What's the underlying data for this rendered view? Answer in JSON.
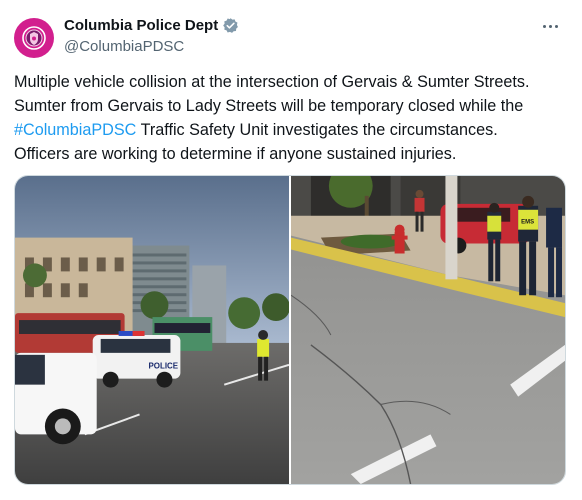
{
  "account": {
    "display_name": "Columbia Police Dept",
    "handle": "@ColumbiaPDSC",
    "verified": true,
    "avatar_color": "#d21f8e"
  },
  "tweet": {
    "line1": "Multiple vehicle collision at the intersection of Gervais & Sumter Streets.",
    "line2": "Sumter from Gervais to Lady Streets will be temporary closed while the",
    "line3_hashtag": "#ColumbiaPDSC",
    "line3_rest": " Traffic Safety Unit investigates the circumstances.",
    "line4": "Officers are working to determine if anyone sustained injuries."
  },
  "media": {
    "photo_left": {
      "vehicle_label": "POLICE"
    },
    "photo_right": {
      "vest_label": "EMS"
    }
  },
  "colors": {
    "link": "#1d9bf0",
    "text": "#0f1419",
    "secondary": "#536471",
    "verified": "#829aab"
  }
}
